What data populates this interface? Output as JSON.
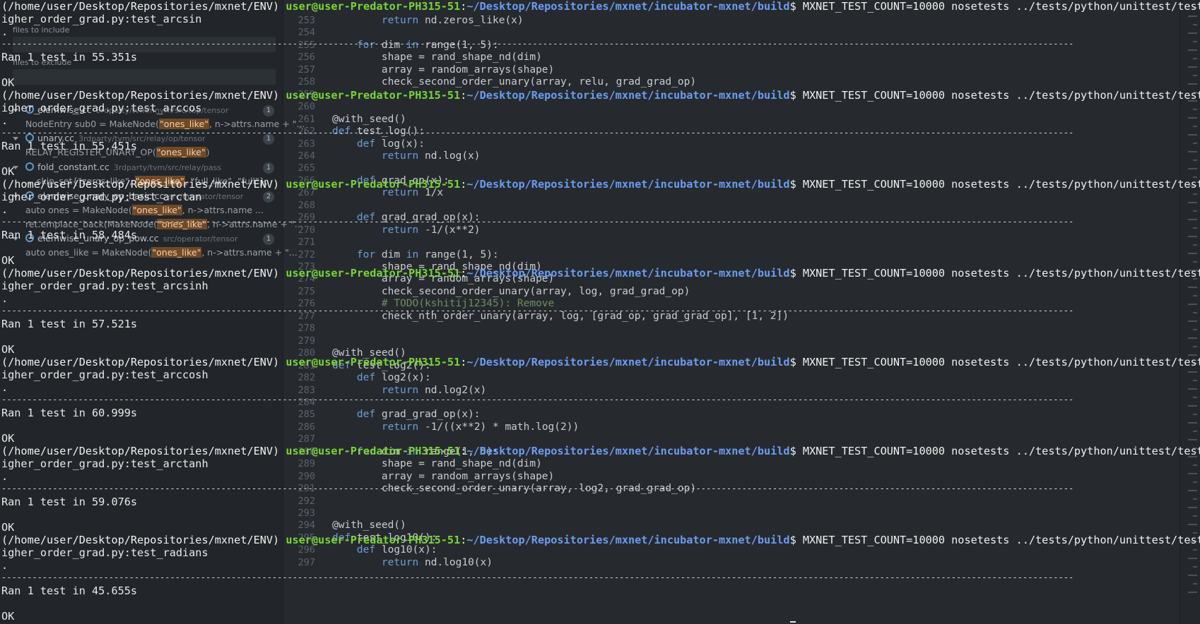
{
  "editor": {
    "search_panel": {
      "files_to_include_label": "files to include",
      "files_to_exclude_label": "files to exclude",
      "results": [
        {
          "file": "elemwise.cc",
          "path": "3rdparty/tvm/nnvm/src/top/tensor",
          "count": "1",
          "line_pre": "NodeEntry sub0 = MakeNode(",
          "match": "\"ones_like\"",
          "line_post": ", n->attrs.name + \"..."
        },
        {
          "file": "unary.cc",
          "path": "3rdparty/tvm/src/relay/op/tensor",
          "count": "1",
          "line_pre": "RELAY_REGISTER_UNARY_OP(",
          "match": "\"ones_like\"",
          "line_post": ")"
        },
        {
          "file": "fold_constant.cc",
          "path": "3rdparty/tvm/src/relay/pass",
          "count": "1",
          "line_pre": "... skip_set{\"zeros_like\", ",
          "match": "\"ones_like\"",
          "line_post": ", \"full_like\", \"full\"};"
        },
        {
          "file": "elemwise_unary_op_basic.cc",
          "path": "src/operator/tensor",
          "count": "2",
          "line_pre": "auto ones = MakeNode(",
          "match": "\"ones_like\"",
          "line_post": ", n->attrs.name ..."
        },
        {
          "file": "",
          "path": "",
          "count": "",
          "line_pre": "ret.emplace_back(MakeNode(",
          "match": "\"ones_like\"",
          "line_post": ", n->attrs.name + \"..."
        },
        {
          "file": "elemwise_unary_op_pow.cc",
          "path": "src/operator/tensor",
          "count": "1",
          "line_pre": "auto ones_like = MakeNode(",
          "match": "\"ones_like\"",
          "line_post": ", n->attrs.name + \"..."
        }
      ]
    },
    "code_lines": [
      {
        "n": "253",
        "text": "        return nd.zeros_like(x)"
      },
      {
        "n": "254",
        "text": ""
      },
      {
        "n": "255",
        "text": "    for dim in range(1, 5):"
      },
      {
        "n": "256",
        "text": "        shape = rand_shape_nd(dim)"
      },
      {
        "n": "257",
        "text": "        array = random_arrays(shape)"
      },
      {
        "n": "258",
        "text": "        check_second_order_unary(array, relu, grad_grad_op)"
      },
      {
        "n": "259",
        "text": ""
      },
      {
        "n": "260",
        "text": ""
      },
      {
        "n": "261",
        "text": "@with_seed()"
      },
      {
        "n": "262",
        "text": "def test_log():"
      },
      {
        "n": "263",
        "text": "    def log(x):"
      },
      {
        "n": "264",
        "text": "        return nd.log(x)"
      },
      {
        "n": "265",
        "text": ""
      },
      {
        "n": "266",
        "text": "    def grad_op(x):"
      },
      {
        "n": "267",
        "text": "        return 1/x"
      },
      {
        "n": "268",
        "text": ""
      },
      {
        "n": "269",
        "text": "    def grad_grad_op(x):"
      },
      {
        "n": "270",
        "text": "        return -1/(x**2)"
      },
      {
        "n": "271",
        "text": ""
      },
      {
        "n": "272",
        "text": "    for dim in range(1, 5):"
      },
      {
        "n": "273",
        "text": "        shape = rand_shape_nd(dim)"
      },
      {
        "n": "274",
        "text": "        array = random_arrays(shape)"
      },
      {
        "n": "275",
        "text": "        check_second_order_unary(array, log, grad_grad_op)"
      },
      {
        "n": "276",
        "text": "        # TODO(kshitij12345): Remove"
      },
      {
        "n": "277",
        "text": "        check_nth_order_unary(array, log, [grad_op, grad_grad_op], [1, 2])"
      },
      {
        "n": "278",
        "text": ""
      },
      {
        "n": "279",
        "text": ""
      },
      {
        "n": "280",
        "text": "@with_seed()"
      },
      {
        "n": "281",
        "text": "def test_log2():"
      },
      {
        "n": "282",
        "text": "    def log2(x):"
      },
      {
        "n": "283",
        "text": "        return nd.log2(x)"
      },
      {
        "n": "284",
        "text": ""
      },
      {
        "n": "285",
        "text": "    def grad_grad_op(x):"
      },
      {
        "n": "286",
        "text": "        return -1/((x**2) * math.log(2))"
      },
      {
        "n": "287",
        "text": ""
      },
      {
        "n": "288",
        "text": "    for dim in range(1, 5):"
      },
      {
        "n": "289",
        "text": "        shape = rand_shape_nd(dim)"
      },
      {
        "n": "290",
        "text": "        array = random_arrays(shape)"
      },
      {
        "n": "291",
        "text": "        check_second_order_unary(array, log2, grad_grad_op)"
      },
      {
        "n": "292",
        "text": ""
      },
      {
        "n": "293",
        "text": ""
      },
      {
        "n": "294",
        "text": "@with_seed()"
      },
      {
        "n": "295",
        "text": "def test_log10():"
      },
      {
        "n": "296",
        "text": "    def log10(x):"
      },
      {
        "n": "297",
        "text": "        return nd.log10(x)"
      }
    ]
  },
  "terminal": {
    "env": "(/home/user/Desktop/Repositories/mxnet/ENV)",
    "user_host": "user@user-Predator-PH315-51",
    "cwd": "~/Desktop/Repositories/mxnet/incubator-mxnet/build",
    "prompt_symbol": "$",
    "command_prefix": "MXNET_TEST_COUNT=10000 nosetests ../tests/python/unittest/test_h",
    "dashes": "----------------------------------------------------------------------",
    "ok": "OK",
    "dot": ".",
    "runs": [
      {
        "test": "igher_order_grad.py:test_arcsin",
        "result": "Ran 1 test in 55.351s"
      },
      {
        "test": "igher_order_grad.py:test_arccos",
        "result": "Ran 1 test in 55.451s"
      },
      {
        "test": "igher_order_grad.py:test_arctan",
        "result": "Ran 1 test in 58.484s"
      },
      {
        "test": "igher_order_grad.py:test_arcsinh",
        "result": "Ran 1 test in 57.521s"
      },
      {
        "test": "igher_order_grad.py:test_arccosh",
        "result": "Ran 1 test in 60.999s"
      },
      {
        "test": "igher_order_grad.py:test_arctanh",
        "result": "Ran 1 test in 59.076s"
      },
      {
        "test": "igher_order_grad.py:test_radians",
        "result": "Ran 1 test in 45.655s"
      }
    ]
  }
}
